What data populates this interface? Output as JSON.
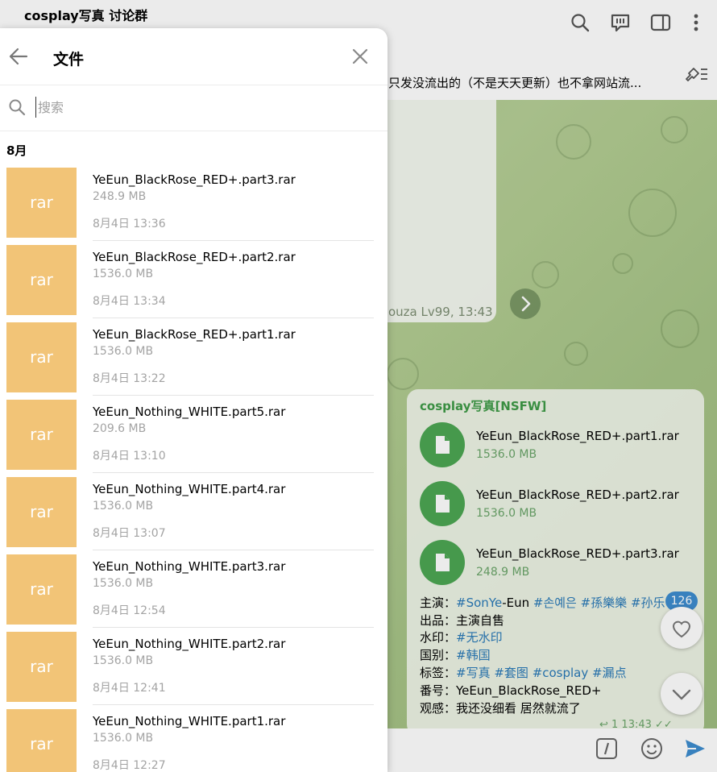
{
  "chat": {
    "title": "cosplay写真 讨论群",
    "pinned_text": "只发没流出的（不是天天更新）也不拿网站流...",
    "top_bubble_meta": "ouza Lv99, 13:43",
    "source": "cosplay写真[NSFW]",
    "documents": [
      {
        "name": "YeEun_BlackRose_RED+.part1.rar",
        "size": "1536.0 MB"
      },
      {
        "name": "YeEun_BlackRose_RED+.part2.rar",
        "size": "1536.0 MB"
      },
      {
        "name": "YeEun_BlackRose_RED+.part3.rar",
        "size": "248.9 MB"
      }
    ],
    "info": {
      "l1_label": "主演：",
      "l1_t1": "#SonYe",
      "l1_plain": "-Eun ",
      "l1_t2": "#손예은 #孫樂樂 #孙乐",
      "l2_label": "出品：",
      "l2_value": "主演自售",
      "l3_label": "水印：",
      "l3_value": "#无水印",
      "l4_label": "国别：",
      "l4_value": "#韩国",
      "l5_label": "标签：",
      "l5_value": "#写真 #套图 #cosplay #漏点",
      "l6_label": "番号：",
      "l6_value": "YeEun_BlackRose_RED+",
      "l7_label": "观感：",
      "l7_value": "我还没细看 居然就流了"
    },
    "views": "126",
    "meta": "↩ 1  13:43 ✓✓",
    "colors": {
      "accent": "#4ca653",
      "link": "#2a7ab8",
      "badge": "#3d8ccf"
    }
  },
  "panel": {
    "title": "文件",
    "search_placeholder": "搜索",
    "month": "8月",
    "files": [
      {
        "ext": "rar",
        "name": "YeEun_BlackRose_RED+.part3.rar",
        "size": "248.9 MB",
        "date": "8月4日 13:36"
      },
      {
        "ext": "rar",
        "name": "YeEun_BlackRose_RED+.part2.rar",
        "size": "1536.0 MB",
        "date": "8月4日 13:34"
      },
      {
        "ext": "rar",
        "name": "YeEun_BlackRose_RED+.part1.rar",
        "size": "1536.0 MB",
        "date": "8月4日 13:22"
      },
      {
        "ext": "rar",
        "name": "YeEun_Nothing_WHITE.part5.rar",
        "size": "209.6 MB",
        "date": "8月4日 13:10"
      },
      {
        "ext": "rar",
        "name": "YeEun_Nothing_WHITE.part4.rar",
        "size": "1536.0 MB",
        "date": "8月4日 13:07"
      },
      {
        "ext": "rar",
        "name": "YeEun_Nothing_WHITE.part3.rar",
        "size": "1536.0 MB",
        "date": "8月4日 12:54"
      },
      {
        "ext": "rar",
        "name": "YeEun_Nothing_WHITE.part2.rar",
        "size": "1536.0 MB",
        "date": "8月4日 12:41"
      },
      {
        "ext": "rar",
        "name": "YeEun_Nothing_WHITE.part1.rar",
        "size": "1536.0 MB",
        "date": "8月4日 12:27"
      }
    ],
    "thumb_color": "#f2c477"
  }
}
